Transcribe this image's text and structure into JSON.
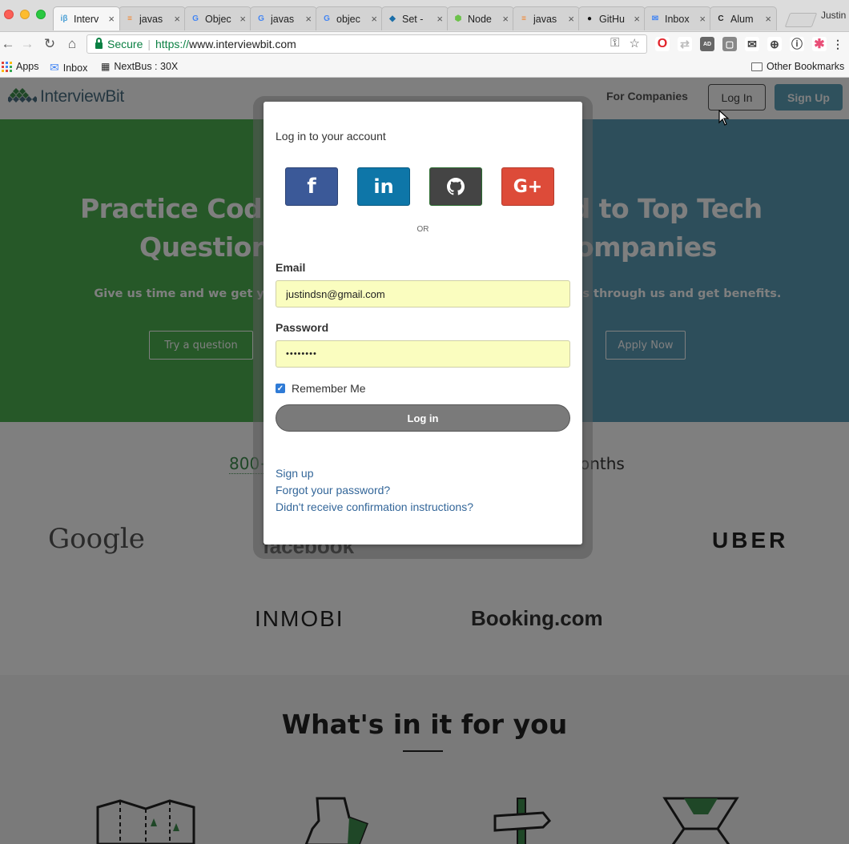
{
  "browser": {
    "tabs": [
      {
        "label": "Interv",
        "favicon": "iβ",
        "favicon_color": "#4a9fd5",
        "active": true
      },
      {
        "label": "javas",
        "favicon": "≡",
        "favicon_color": "#f48024",
        "active": false
      },
      {
        "label": "Objec",
        "favicon": "G",
        "favicon_color": "#4285f4",
        "active": false
      },
      {
        "label": "javas",
        "favicon": "G",
        "favicon_color": "#4285f4",
        "active": false
      },
      {
        "label": "objec",
        "favicon": "G",
        "favicon_color": "#4285f4",
        "active": false
      },
      {
        "label": "Set -",
        "favicon": "◆",
        "favicon_color": "#1a6ea8",
        "active": false
      },
      {
        "label": "Node",
        "favicon": "⬢",
        "favicon_color": "#6cc24a",
        "active": false
      },
      {
        "label": "javas",
        "favicon": "≡",
        "favicon_color": "#f48024",
        "active": false
      },
      {
        "label": "GitHu",
        "favicon": "●",
        "favicon_color": "#111111",
        "active": false
      },
      {
        "label": "Inbox",
        "favicon": "✉",
        "favicon_color": "#4285f4",
        "active": false
      },
      {
        "label": "Alum",
        "favicon": "C",
        "favicon_color": "#222222",
        "active": false
      }
    ],
    "profile_name": "Justin",
    "security_label": "Secure",
    "url_scheme": "https://",
    "url_host": "www.interviewbit.com",
    "bookmarks": {
      "apps": "Apps",
      "inbox": "Inbox",
      "nextbus": "NextBus : 30X",
      "other": "Other Bookmarks"
    }
  },
  "site": {
    "logo": "InterviewBit",
    "nav": {
      "companies": "For Companies",
      "login": "Log In",
      "signup": "Sign Up"
    },
    "hero_left": {
      "title_line1": "Practice Coding In",
      "title_line2": "Questions",
      "subtitle": "Give us time and we get you the job",
      "button": "Try a question"
    },
    "hero_right": {
      "title_line1": "erred to Top Tech",
      "title_line2": "Companies",
      "subtitle": "ech companies through us and get benefits.",
      "button": "Apply Now"
    },
    "stats": {
      "left": "800+",
      "right": "onths"
    },
    "company_logos": [
      "Google",
      "facebook",
      "UBER",
      "INMOBI",
      "Booking.com"
    ],
    "benefits_title": "What's in it for you"
  },
  "modal": {
    "title": "Log in to your account",
    "social": {
      "facebook": "f",
      "linkedin": "in",
      "google": "G+"
    },
    "or_label": "OR",
    "email_label": "Email",
    "email_value": "justindsn@gmail.com",
    "password_label": "Password",
    "password_value": "••••••••",
    "remember_label": "Remember Me",
    "remember_checked": true,
    "submit_label": "Log in",
    "links": {
      "signup": "Sign up",
      "forgot": "Forgot your password?",
      "confirm": "Didn't receive confirmation instructions?"
    }
  },
  "colors": {
    "hero_left": "#4cb050",
    "hero_right": "#5b9db7",
    "signup_button": "#5fa2bb",
    "autofill_field": "#fafdbf",
    "link": "#336699"
  }
}
